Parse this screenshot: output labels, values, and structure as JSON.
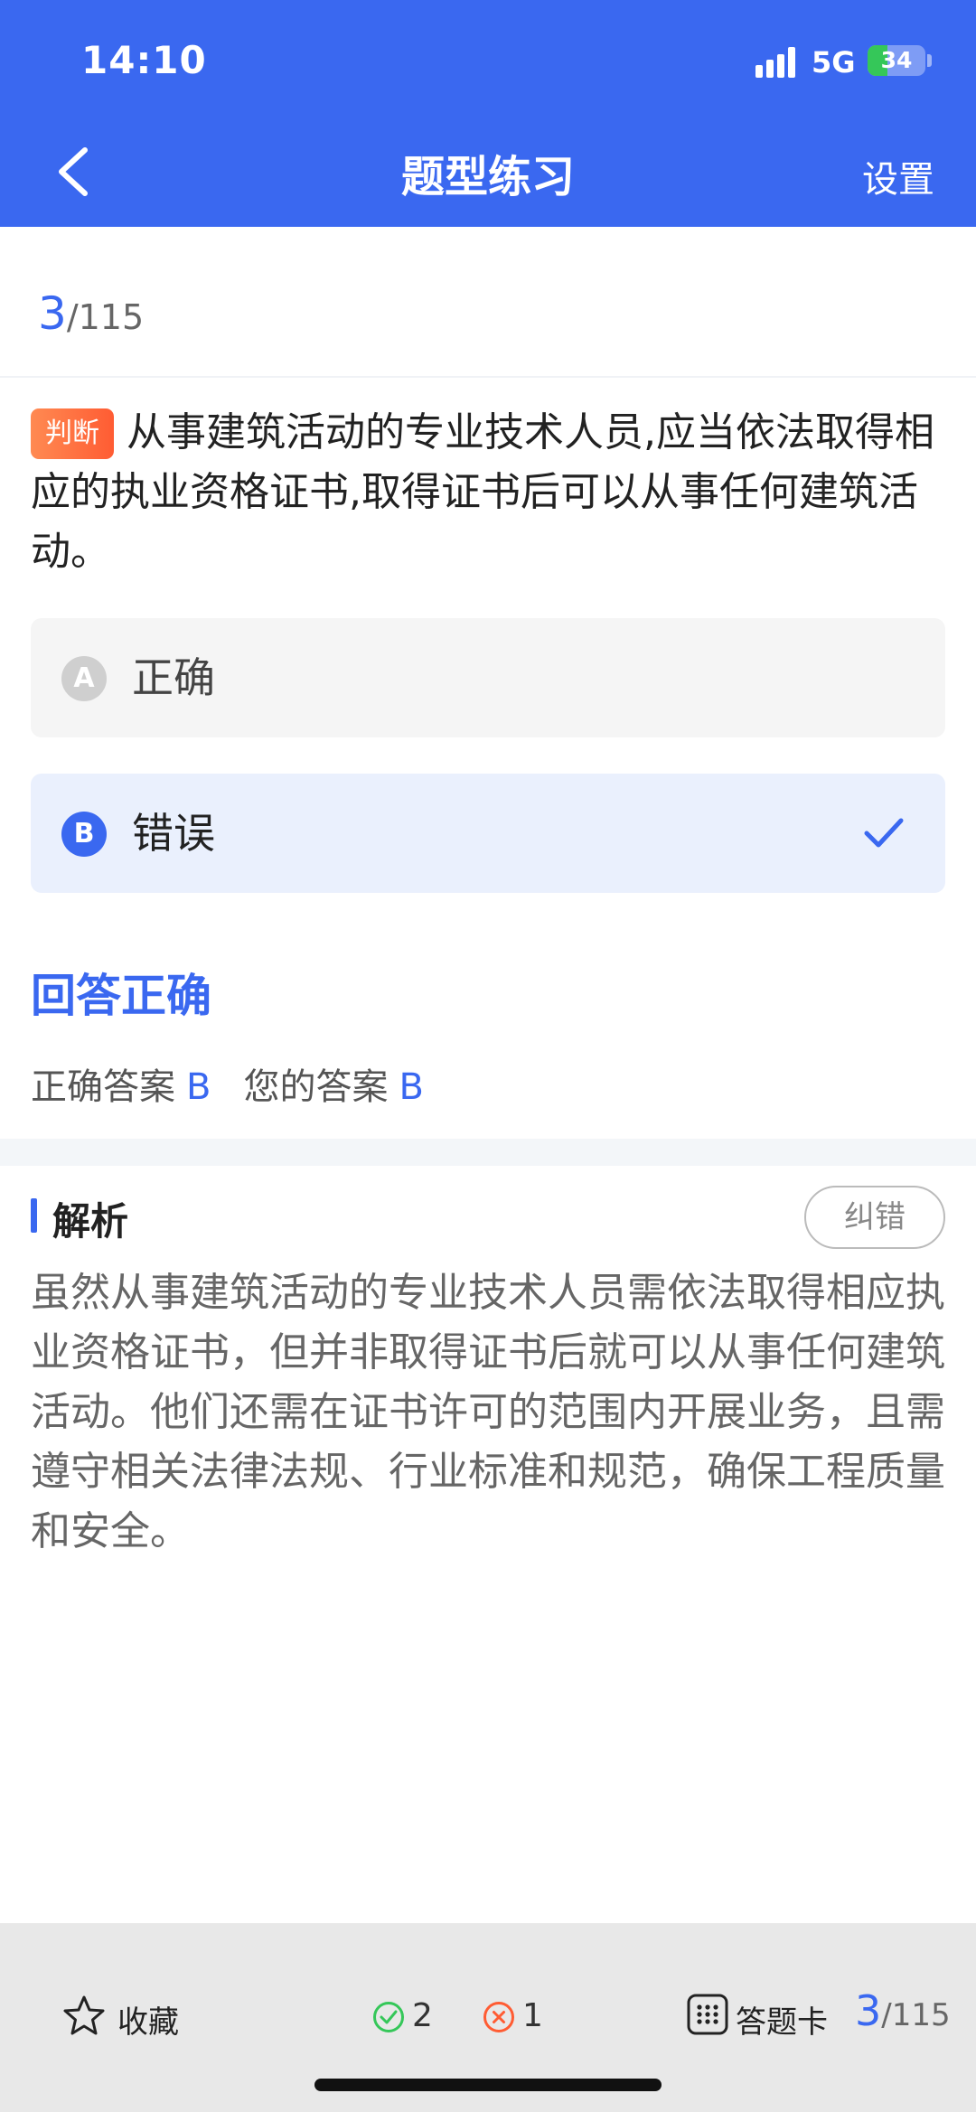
{
  "status_bar": {
    "time": "14:10",
    "network": "5G",
    "battery_percent": 34,
    "battery_text": "34"
  },
  "header": {
    "title": "题型练习",
    "settings_label": "设置",
    "back_icon": "chevron-left-icon"
  },
  "progress": {
    "current": "3",
    "total": "/115"
  },
  "question": {
    "tag": "判断",
    "text": "从事建筑活动的专业技术人员,应当依法取得相应的执业资格证书,取得证书后可以从事任何建筑活动。"
  },
  "options": [
    {
      "letter": "A",
      "text": "正确"
    },
    {
      "letter": "B",
      "text": "错误",
      "selected": true
    }
  ],
  "result": {
    "status": "回答正确",
    "correct_label": "正确答案",
    "correct_value": "B",
    "yours_label": "您的答案",
    "yours_value": "B"
  },
  "analysis": {
    "title": "解析",
    "report_label": "纠错",
    "text": "虽然从事建筑活动的专业技术人员需依法取得相应执业资格证书，但并非取得证书后就可以从事任何建筑活动。他们还需在证书许可的范围内开展业务，且需遵守相关法律法规、行业标准和规范，确保工程质量和安全。"
  },
  "bottom_bar": {
    "favorite_label": "收藏",
    "correct_count": "2",
    "wrong_count": "1",
    "card_label": "答题卡",
    "progress_current": "3",
    "progress_total": "/115"
  },
  "colors": {
    "accent": "#3a68f0",
    "tag": "#ff6a3d",
    "correct": "#35c759",
    "wrong": "#ff5c33"
  }
}
